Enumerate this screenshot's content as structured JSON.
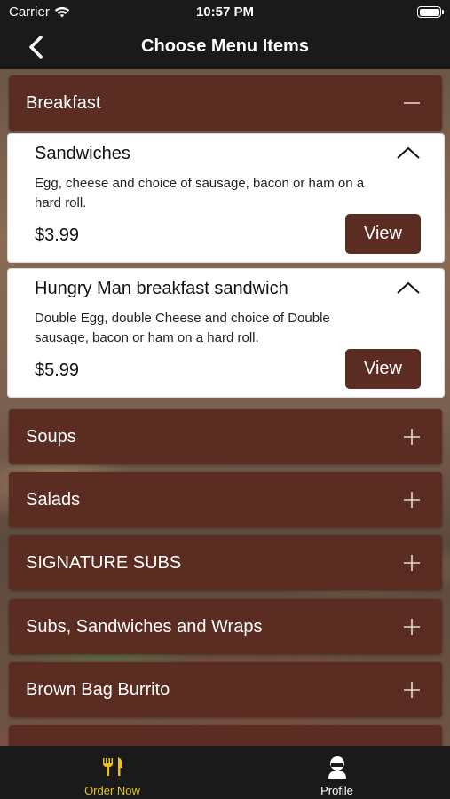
{
  "status": {
    "carrier": "Carrier",
    "time": "10:57 PM"
  },
  "nav": {
    "title": "Choose Menu Items",
    "back_icon": "chevron-left-icon"
  },
  "categories": [
    {
      "label": "Breakfast",
      "expanded": true
    },
    {
      "label": "Soups",
      "expanded": false
    },
    {
      "label": "Salads",
      "expanded": false
    },
    {
      "label": "SIGNATURE SUBS",
      "expanded": false
    },
    {
      "label": "Subs, Sandwiches and Wraps",
      "expanded": false
    },
    {
      "label": "Brown Bag Burrito",
      "expanded": false
    }
  ],
  "items": [
    {
      "title": "Sandwiches",
      "description": "Egg, cheese and choice of sausage, bacon or ham on a  hard roll.",
      "price": "$3.99",
      "button": "View"
    },
    {
      "title": "Hungry Man breakfast sandwich",
      "description": "Double Egg,  double Cheese and choice of Double sausage, bacon or ham on a hard roll.",
      "price": "$5.99",
      "button": "View"
    }
  ],
  "tabs": [
    {
      "label": "Order Now",
      "icon": "utensils-icon",
      "active": true
    },
    {
      "label": "Profile",
      "icon": "chef-icon",
      "active": false
    }
  ],
  "colors": {
    "accent": "#5b2c21",
    "active_tab": "#e8c21a",
    "bar": "#1a1a1a"
  }
}
